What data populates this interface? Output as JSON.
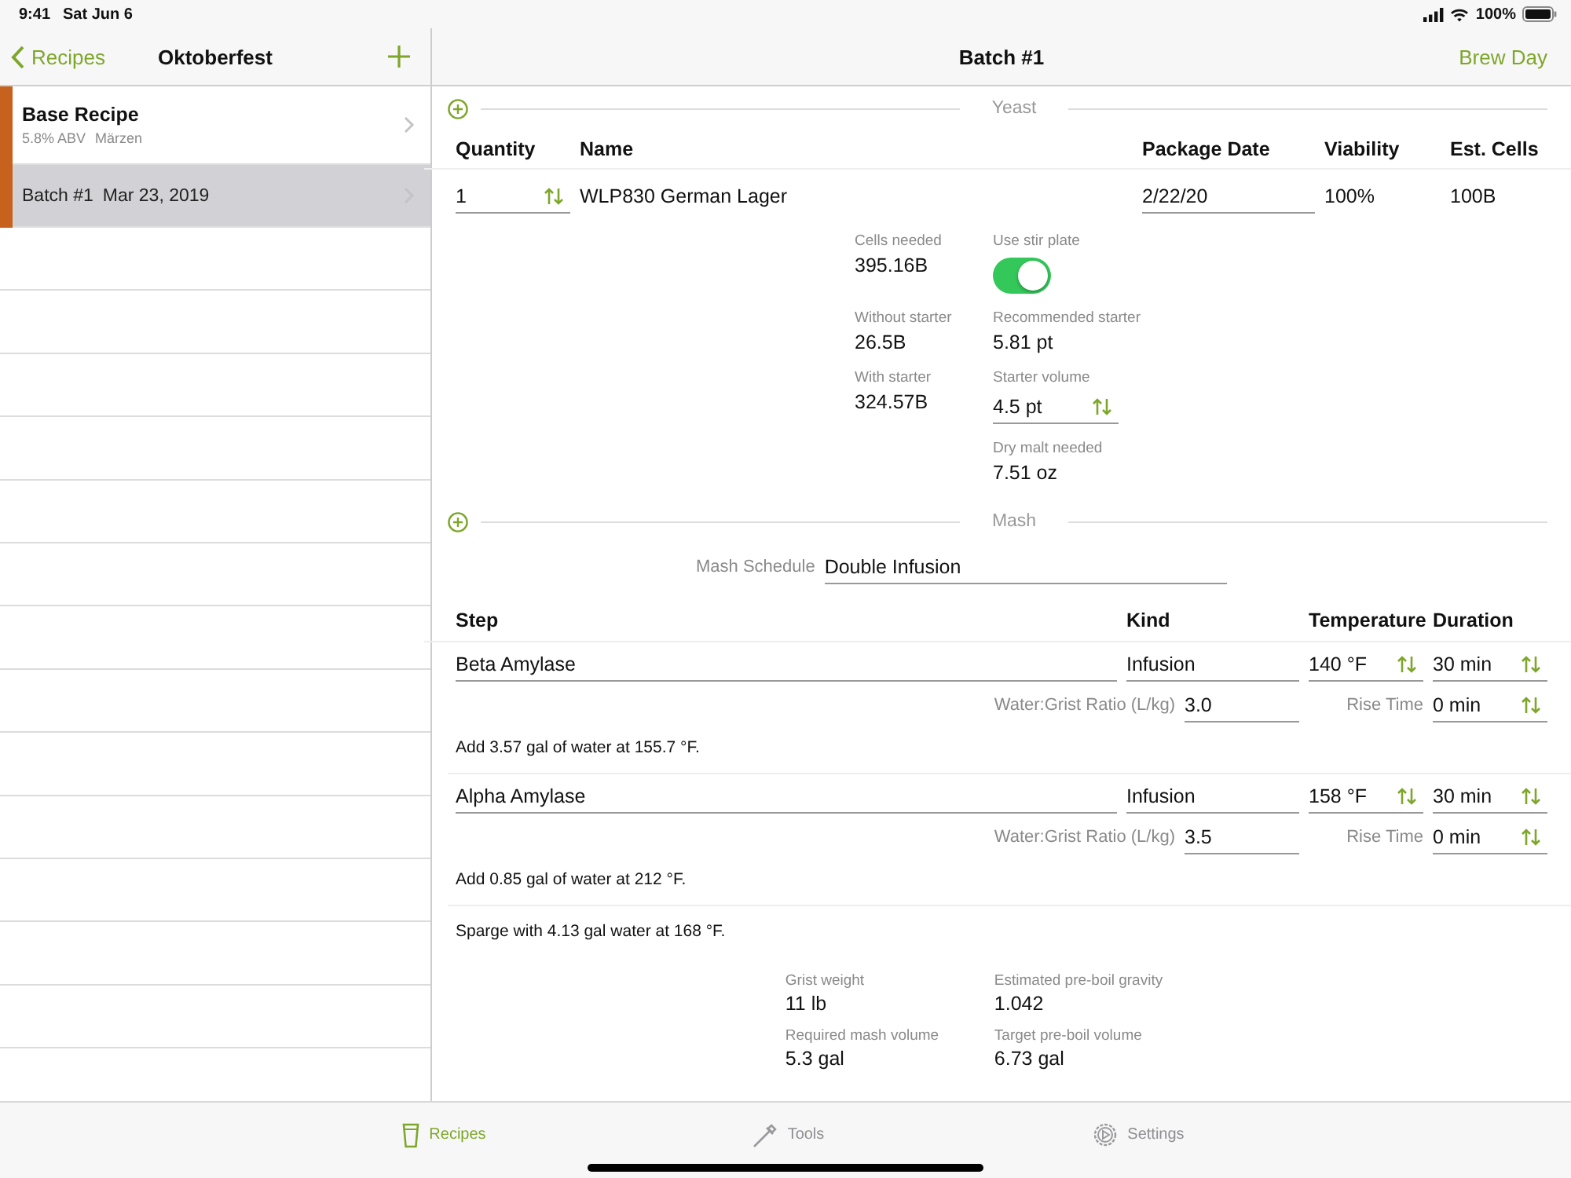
{
  "status_bar": {
    "time": "9:41",
    "date": "Sat Jun 6",
    "battery": "100%"
  },
  "sidebar": {
    "back": "Recipes",
    "title": "Oktoberfest",
    "items": [
      {
        "kind": "recipe",
        "title": "Base Recipe",
        "details": [
          "5.8% ABV",
          "Märzen"
        ],
        "selected": false
      },
      {
        "kind": "batch",
        "title": "Batch #1",
        "details": [
          "Mar 23, 2019"
        ],
        "selected": true
      }
    ]
  },
  "detail": {
    "title": "Batch #1",
    "action": "Brew Day"
  },
  "yeast": {
    "section": "Yeast",
    "columns": [
      "Quantity",
      "Name",
      "Package Date",
      "Viability",
      "Est. Cells"
    ],
    "rows": [
      {
        "quantity": "1",
        "name": "WLP830 German Lager",
        "package_date": "2/22/20",
        "viability": "100%",
        "est_cells": "100B"
      }
    ]
  },
  "starter": {
    "left": [
      {
        "kind": "value",
        "label": "Cells needed",
        "value": "395.16B"
      },
      {
        "kind": "value",
        "label": "Without starter",
        "value": "26.5B"
      },
      {
        "kind": "value",
        "label": "With starter",
        "value": "324.57B"
      }
    ],
    "right": [
      {
        "kind": "toggle",
        "label": "Use stir plate",
        "on": true
      },
      {
        "kind": "value",
        "label": "Recommended starter",
        "value": "5.81 pt"
      },
      {
        "kind": "stepper",
        "label": "Starter volume",
        "value": "4.5 pt"
      },
      {
        "kind": "value",
        "label": "Dry malt needed",
        "value": "7.51 oz"
      }
    ]
  },
  "mash": {
    "section": "Mash",
    "schedule_label": "Mash Schedule",
    "schedule": "Double Infusion",
    "columns": [
      "Step",
      "Kind",
      "Temperature",
      "Duration"
    ],
    "steps": [
      {
        "name": "Beta Amylase",
        "kind_value": "Infusion",
        "temperature": "140 °F",
        "duration": "30 min",
        "ratio_label": "Water:Grist Ratio (L/kg)",
        "ratio": "3.0",
        "rise_label": "Rise Time",
        "rise": "0 min",
        "note": "Add 3.57 gal of water at 155.7 °F."
      },
      {
        "name": "Alpha Amylase",
        "kind_value": "Infusion",
        "temperature": "158 °F",
        "duration": "30 min",
        "ratio_label": "Water:Grist Ratio (L/kg)",
        "ratio": "3.5",
        "rise_label": "Rise Time",
        "rise": "0 min",
        "note": "Add 0.85 gal of water at 212 °F."
      }
    ],
    "sparge": "Sparge with 4.13 gal water at 168 °F.",
    "summary": {
      "left": [
        {
          "label": "Grist weight",
          "value": "11 lb"
        },
        {
          "label": "Required mash volume",
          "value": "5.3 gal"
        }
      ],
      "right": [
        {
          "label": "Estimated pre-boil gravity",
          "value": "1.042"
        },
        {
          "label": "Target pre-boil volume",
          "value": "6.73 gal"
        }
      ]
    }
  },
  "tabs": [
    {
      "kind": "recipes",
      "label": "Recipes",
      "selected": true
    },
    {
      "kind": "tools",
      "label": "Tools",
      "selected": false
    },
    {
      "kind": "settings",
      "label": "Settings",
      "selected": false
    }
  ]
}
